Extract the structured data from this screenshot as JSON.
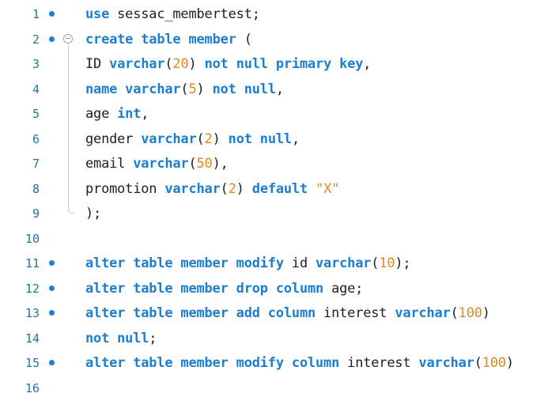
{
  "editor": {
    "lines": [
      {
        "number": "1",
        "breakpoint": true,
        "fold": "none",
        "tokens": [
          {
            "t": "kw",
            "v": "use"
          },
          {
            "t": "plain",
            "v": " sessac_membertest;"
          }
        ]
      },
      {
        "number": "2",
        "breakpoint": true,
        "fold": "start",
        "tokens": [
          {
            "t": "kw",
            "v": "create table"
          },
          {
            "t": "plain",
            "v": " "
          },
          {
            "t": "kw",
            "v": "member"
          },
          {
            "t": "plain",
            "v": " ("
          }
        ]
      },
      {
        "number": "3",
        "breakpoint": false,
        "fold": "guide",
        "tokens": [
          {
            "t": "plain",
            "v": "ID "
          },
          {
            "t": "kw",
            "v": "varchar"
          },
          {
            "t": "plain",
            "v": "("
          },
          {
            "t": "num",
            "v": "20"
          },
          {
            "t": "plain",
            "v": ") "
          },
          {
            "t": "kw",
            "v": "not null primary key"
          },
          {
            "t": "plain",
            "v": ","
          }
        ]
      },
      {
        "number": "4",
        "breakpoint": false,
        "fold": "guide",
        "tokens": [
          {
            "t": "kw",
            "v": "name varchar"
          },
          {
            "t": "plain",
            "v": "("
          },
          {
            "t": "num",
            "v": "5"
          },
          {
            "t": "plain",
            "v": ") "
          },
          {
            "t": "kw",
            "v": "not null"
          },
          {
            "t": "plain",
            "v": ","
          }
        ]
      },
      {
        "number": "5",
        "breakpoint": false,
        "fold": "guide",
        "tokens": [
          {
            "t": "plain",
            "v": "age "
          },
          {
            "t": "kw",
            "v": "int"
          },
          {
            "t": "plain",
            "v": ","
          }
        ]
      },
      {
        "number": "6",
        "breakpoint": false,
        "fold": "guide",
        "tokens": [
          {
            "t": "plain",
            "v": "gender "
          },
          {
            "t": "kw",
            "v": "varchar"
          },
          {
            "t": "plain",
            "v": "("
          },
          {
            "t": "num",
            "v": "2"
          },
          {
            "t": "plain",
            "v": ") "
          },
          {
            "t": "kw",
            "v": "not null"
          },
          {
            "t": "plain",
            "v": ","
          }
        ]
      },
      {
        "number": "7",
        "breakpoint": false,
        "fold": "guide",
        "tokens": [
          {
            "t": "plain",
            "v": "email "
          },
          {
            "t": "kw",
            "v": "varchar"
          },
          {
            "t": "plain",
            "v": "("
          },
          {
            "t": "num",
            "v": "50"
          },
          {
            "t": "plain",
            "v": "),"
          }
        ]
      },
      {
        "number": "8",
        "breakpoint": false,
        "fold": "guide",
        "tokens": [
          {
            "t": "plain",
            "v": "promotion "
          },
          {
            "t": "kw",
            "v": "varchar"
          },
          {
            "t": "plain",
            "v": "("
          },
          {
            "t": "num",
            "v": "2"
          },
          {
            "t": "plain",
            "v": ") "
          },
          {
            "t": "kw",
            "v": "default"
          },
          {
            "t": "plain",
            "v": " "
          },
          {
            "t": "str",
            "v": "\"X\""
          }
        ]
      },
      {
        "number": "9",
        "breakpoint": false,
        "fold": "end",
        "tokens": [
          {
            "t": "plain",
            "v": ");"
          }
        ]
      },
      {
        "number": "10",
        "breakpoint": false,
        "fold": "none",
        "tokens": []
      },
      {
        "number": "11",
        "breakpoint": true,
        "fold": "none",
        "tokens": [
          {
            "t": "kw",
            "v": "alter table member modify"
          },
          {
            "t": "plain",
            "v": " id "
          },
          {
            "t": "kw",
            "v": "varchar"
          },
          {
            "t": "plain",
            "v": "("
          },
          {
            "t": "num",
            "v": "10"
          },
          {
            "t": "plain",
            "v": ");"
          }
        ]
      },
      {
        "number": "12",
        "breakpoint": true,
        "fold": "none",
        "tokens": [
          {
            "t": "kw",
            "v": "alter table member drop column"
          },
          {
            "t": "plain",
            "v": " age;"
          }
        ]
      },
      {
        "number": "13",
        "breakpoint": true,
        "fold": "none",
        "tokens": [
          {
            "t": "kw",
            "v": "alter table member add column"
          },
          {
            "t": "plain",
            "v": " interest "
          },
          {
            "t": "kw",
            "v": "varchar"
          },
          {
            "t": "plain",
            "v": "("
          },
          {
            "t": "num",
            "v": "100"
          },
          {
            "t": "plain",
            "v": ")"
          }
        ]
      },
      {
        "number": "14",
        "breakpoint": false,
        "fold": "none",
        "tokens": [
          {
            "t": "kw",
            "v": "not null"
          },
          {
            "t": "plain",
            "v": ";"
          }
        ]
      },
      {
        "number": "15",
        "breakpoint": true,
        "fold": "none",
        "tokens": [
          {
            "t": "kw",
            "v": "alter table member modify column"
          },
          {
            "t": "plain",
            "v": " interest "
          },
          {
            "t": "kw",
            "v": "varchar"
          },
          {
            "t": "plain",
            "v": "("
          },
          {
            "t": "num",
            "v": "100"
          },
          {
            "t": "plain",
            "v": ") "
          }
        ]
      },
      {
        "number": "16",
        "breakpoint": false,
        "fold": "none",
        "tokens": []
      }
    ]
  },
  "colors": {
    "keyword": "#1a7fd0",
    "number": "#e08a1e",
    "text": "#202020",
    "line_number": "#237893",
    "breakpoint": "#1e7fd8"
  },
  "icons": {
    "breakpoint": "breakpoint-dot-icon",
    "fold": "fold-collapse-icon"
  }
}
